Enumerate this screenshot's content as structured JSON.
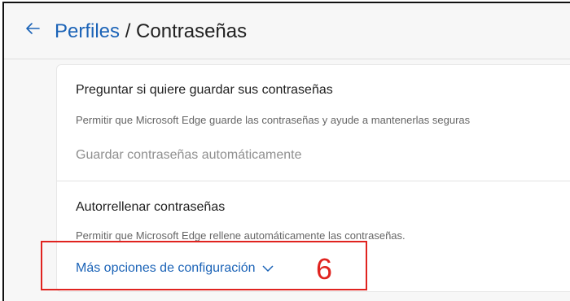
{
  "header": {
    "breadcrumb_parent": "Perfiles",
    "breadcrumb_separator": " / ",
    "page_title": "Contraseñas"
  },
  "offer_save": {
    "title": "Preguntar si quiere guardar sus contraseñas",
    "description": "Permitir que Microsoft Edge guarde las contraseñas y ayude a mantenerlas seguras",
    "auto_save_label": "Guardar contraseñas automáticamente"
  },
  "autofill": {
    "title": "Autorrellenar contraseñas",
    "description": "Permitir que Microsoft Edge rellene automáticamente las contraseñas.",
    "more_options_label": "Más opciones de configuración"
  },
  "annotation": {
    "number": "6",
    "color": "#e0231f"
  },
  "icons": {
    "back": "back-arrow-icon",
    "expand": "chevron-down-icon"
  },
  "colors": {
    "link": "#1b63b7",
    "background": "#f7f7f7",
    "card": "#ffffff"
  }
}
